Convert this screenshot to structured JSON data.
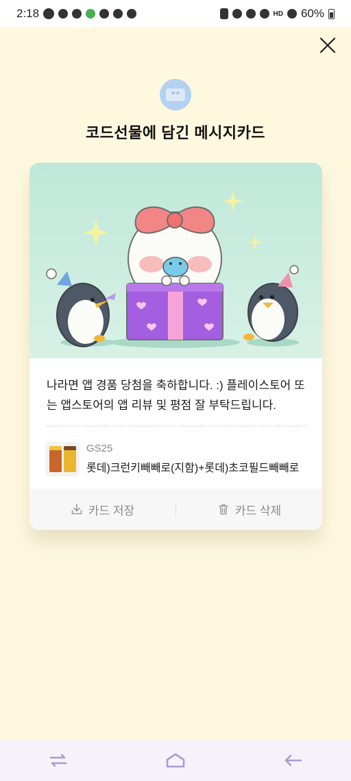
{
  "status_bar": {
    "time": "2:18",
    "talk_badge": "TALK",
    "hd_label": "HD",
    "battery": "60%"
  },
  "dialog": {
    "title": "코드선물에 담긴 메시지카드",
    "header_icon_text": "**",
    "close_icon": "close-icon"
  },
  "card": {
    "message": "나라면 앱 경품 당첨을 축하합니다. :) 플레이스토어 또는 앱스토어의 앱 리뷰 및 평점 잘 부탁드립니다.",
    "product": {
      "brand": "GS25",
      "name": "롯데)크런키빼빼로(지함)+롯데)초코필드빼빼로"
    },
    "actions": {
      "save_label": "카드 저장",
      "delete_label": "카드 삭제"
    }
  },
  "colors": {
    "background": "#fef8df",
    "illustration_bg": "#bfe8d8",
    "gift_box": "#a45ee0",
    "bow": "#f08080",
    "muted_text": "#8a8a8a",
    "nav_icon": "#a99ad6"
  },
  "nav": {
    "recent_icon": "recent-apps-icon",
    "home_icon": "home-icon",
    "back_icon": "back-icon"
  }
}
